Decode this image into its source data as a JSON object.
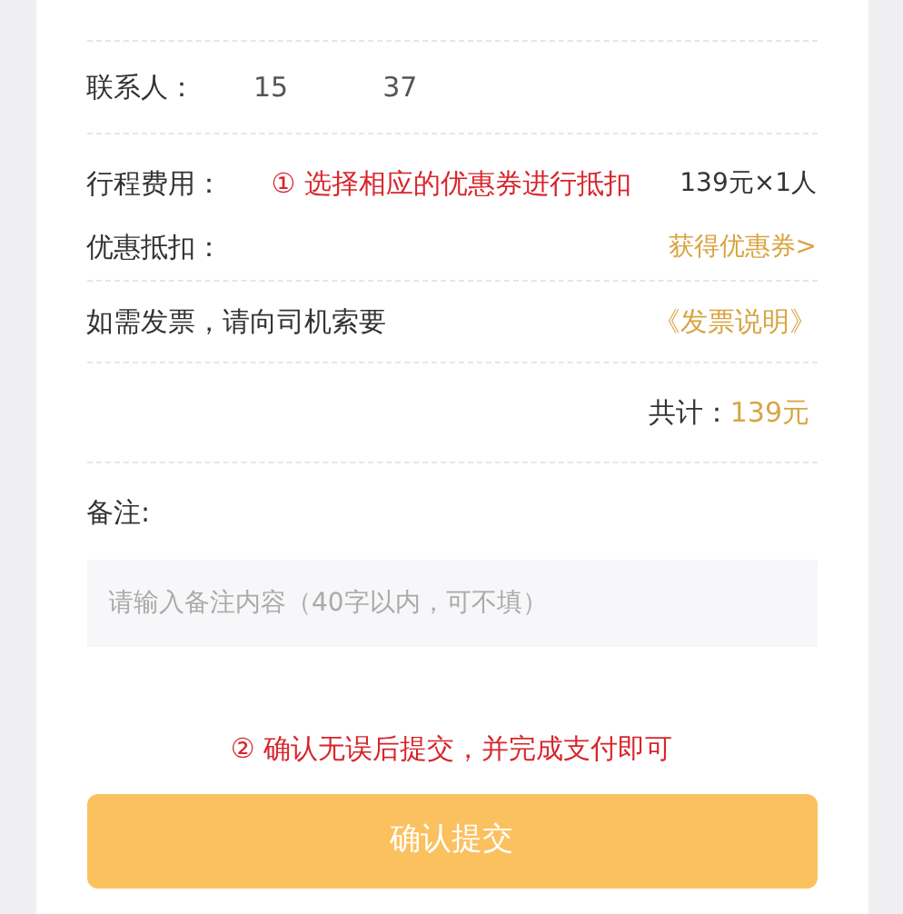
{
  "contact": {
    "label": "联系人：",
    "phone_start": "15",
    "phone_end": "37"
  },
  "fare": {
    "label": "行程费用：",
    "annotation": "① 选择相应的优惠券进行抵扣",
    "amount": "139元×1人"
  },
  "discount": {
    "label": "优惠抵扣：",
    "link": "获得优惠券>"
  },
  "invoice": {
    "text": "如需发票，请向司机索要",
    "link": "《发票说明》"
  },
  "total": {
    "label": "共计：",
    "amount": "139元"
  },
  "remark": {
    "label": "备注:",
    "placeholder": "请输入备注内容（40字以内，可不填）"
  },
  "submit_annotation": "② 确认无误后提交，并完成支付即可",
  "submit_button": "确认提交"
}
